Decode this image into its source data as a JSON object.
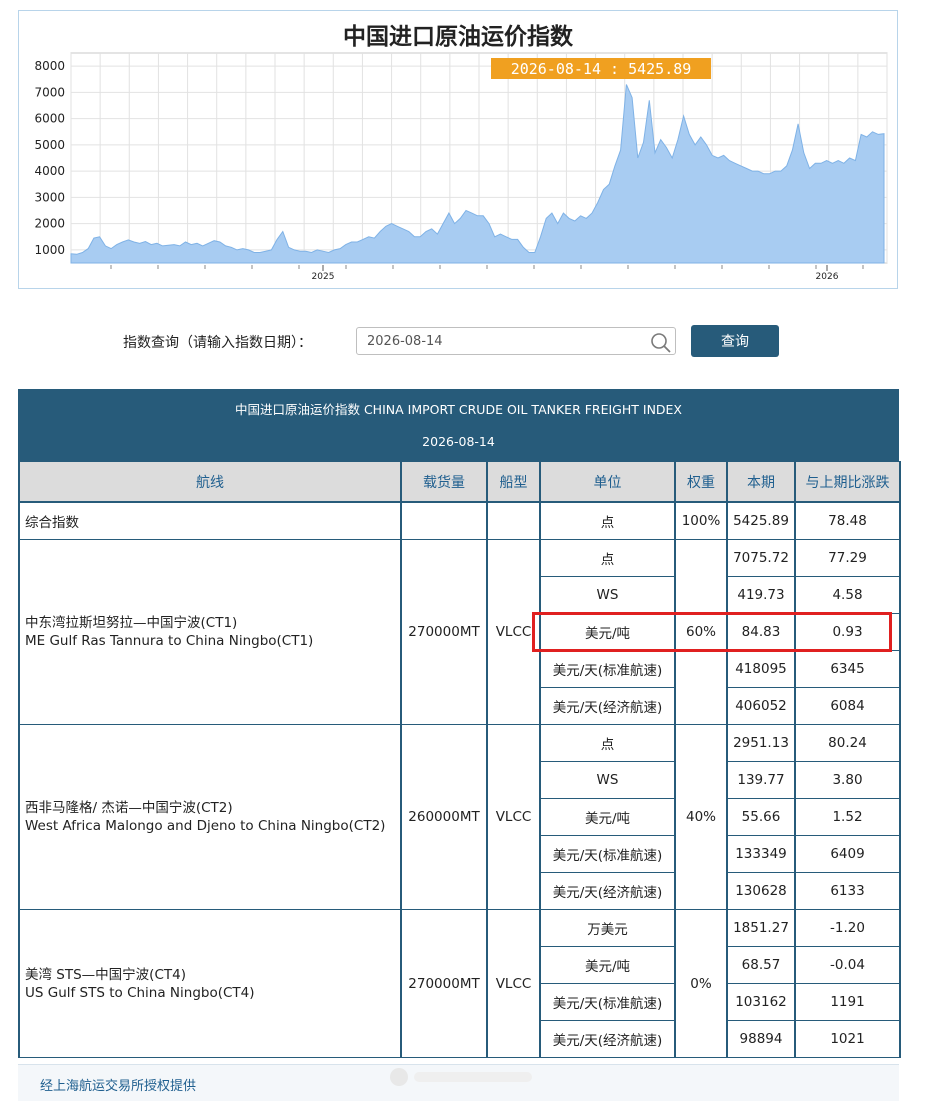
{
  "chart": {
    "title": "中国进口原油运价指数",
    "tooltip": "2026-08-14 : 5425.89",
    "y_ticks": [
      "1000",
      "2000",
      "3000",
      "4000",
      "5000",
      "6000",
      "7000",
      "8000"
    ],
    "x_ticks": [
      "2025",
      "2026"
    ],
    "fill_color": "#a8ccf2",
    "line_color": "#7fb2e6",
    "tooltip_bg": "#f0a020"
  },
  "chart_data": {
    "type": "area",
    "title": "中国进口原油运价指数",
    "xlabel": "",
    "ylabel": "",
    "ylim": [
      500,
      8500
    ],
    "grid": true,
    "x_ticks": [
      "2025",
      "2026"
    ],
    "series": [
      {
        "values": [
          850,
          830,
          900,
          1050,
          1450,
          1500,
          1150,
          1050,
          1200,
          1300,
          1380,
          1300,
          1250,
          1320,
          1200,
          1250,
          1150,
          1180,
          1200,
          1150,
          1300,
          1200,
          1250,
          1150,
          1250,
          1350,
          1300,
          1150,
          1100,
          1000,
          1050,
          1000,
          900,
          900,
          950,
          1000,
          1400,
          1700,
          1100,
          1000,
          950,
          950,
          900,
          1000,
          950,
          900,
          1000,
          1050,
          1200,
          1300,
          1300,
          1400,
          1500,
          1450,
          1700,
          1900,
          2000,
          1900,
          1800,
          1700,
          1500,
          1500,
          1700,
          1800,
          1600,
          2000,
          2400,
          2000,
          2200,
          2500,
          2400,
          2300,
          2300,
          2000,
          1500,
          1600,
          1500,
          1400,
          1400,
          1100,
          900,
          900,
          1500,
          2200,
          2400,
          2000,
          2400,
          2200,
          2100,
          2300,
          2200,
          2400,
          2800,
          3300,
          3500,
          4200,
          4800,
          7300,
          6800,
          4500,
          5100,
          6700,
          4700,
          5200,
          4900,
          4500,
          5200,
          6100,
          5400,
          5000,
          5300,
          5000,
          4600,
          4500,
          4600,
          4400,
          4300,
          4200,
          4100,
          4000,
          4000,
          3900,
          3900,
          4000,
          4000,
          4200,
          4800,
          5800,
          4700,
          4100,
          4300,
          4300,
          4400,
          4300,
          4400,
          4300,
          4500,
          4400,
          5400,
          5300,
          5500,
          5400,
          5425.89
        ]
      }
    ]
  },
  "query": {
    "label": "指数查询（请输入指数日期）：",
    "input_value": "2026-08-14",
    "button_label": "查询"
  },
  "table": {
    "title": "中国进口原油运价指数 CHINA IMPORT CRUDE OIL TANKER FREIGHT INDEX",
    "date": "2026-08-14",
    "headers": [
      "航线",
      "载货量",
      "船型",
      "单位",
      "权重",
      "本期",
      "与上期比涨跌"
    ],
    "composite": {
      "name": "综合指数",
      "unit": "点",
      "weight": "100%",
      "current": "5425.89",
      "change": "78.48"
    },
    "routes": [
      {
        "name_cn": "中东湾拉斯坦努拉—中国宁波(CT1)",
        "name_en": "ME Gulf Ras Tannura to China Ningbo(CT1)",
        "capacity": "270000MT",
        "ship": "VLCC",
        "weight": "60%",
        "rows": [
          {
            "unit": "点",
            "current": "7075.72",
            "change": "77.29"
          },
          {
            "unit": "WS",
            "current": "419.73",
            "change": "4.58"
          },
          {
            "unit": "美元/吨",
            "current": "84.83",
            "change": "0.93"
          },
          {
            "unit": "美元/天(标准航速)",
            "current": "418095",
            "change": "6345"
          },
          {
            "unit": "美元/天(经济航速)",
            "current": "406052",
            "change": "6084"
          }
        ]
      },
      {
        "name_cn": "西非马隆格/ 杰诺—中国宁波(CT2)",
        "name_en": "West Africa Malongo and Djeno to China Ningbo(CT2)",
        "capacity": "260000MT",
        "ship": "VLCC",
        "weight": "40%",
        "rows": [
          {
            "unit": "点",
            "current": "2951.13",
            "change": "80.24"
          },
          {
            "unit": "WS",
            "current": "139.77",
            "change": "3.80"
          },
          {
            "unit": "美元/吨",
            "current": "55.66",
            "change": "1.52"
          },
          {
            "unit": "美元/天(标准航速)",
            "current": "133349",
            "change": "6409"
          },
          {
            "unit": "美元/天(经济航速)",
            "current": "130628",
            "change": "6133"
          }
        ]
      },
      {
        "name_cn": "美湾 STS—中国宁波(CT4)",
        "name_en": "US Gulf STS to China Ningbo(CT4)",
        "capacity": "270000MT",
        "ship": "VLCC",
        "weight": "0%",
        "rows": [
          {
            "unit": "万美元",
            "current": "1851.27",
            "change": "-1.20"
          },
          {
            "unit": "美元/吨",
            "current": "68.57",
            "change": "-0.04"
          },
          {
            "unit": "美元/天(标准航速)",
            "current": "103162",
            "change": "1191"
          },
          {
            "unit": "美元/天(经济航速)",
            "current": "98894",
            "change": "1021"
          }
        ]
      }
    ]
  },
  "footer": {
    "text": "经上海航运交易所授权提供"
  },
  "highlight": {
    "color": "#e02020"
  }
}
